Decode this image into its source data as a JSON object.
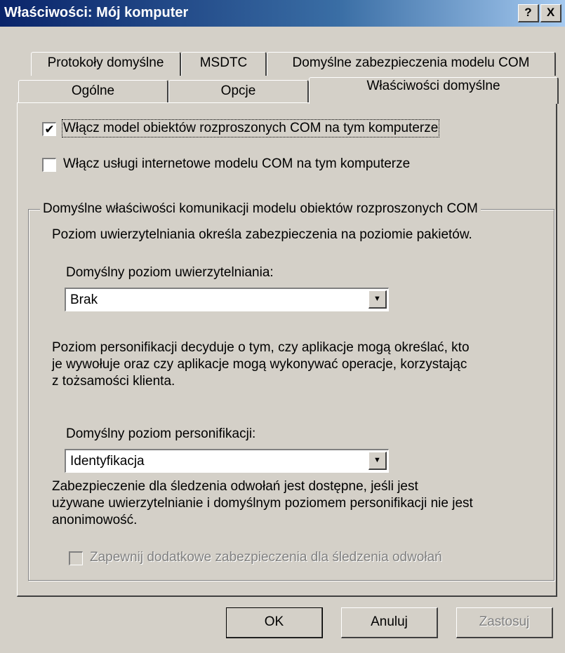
{
  "window": {
    "title": "Właściwości: Mój komputer",
    "help_btn": "?",
    "close_btn": "X"
  },
  "tabs": {
    "row1": [
      {
        "label": "Protokoły domyślne"
      },
      {
        "label": "MSDTC"
      },
      {
        "label": "Domyślne zabezpieczenia modelu COM"
      }
    ],
    "row2": [
      {
        "label": "Ogólne"
      },
      {
        "label": "Opcje"
      },
      {
        "label": "Właściwości domyślne",
        "active": true
      }
    ]
  },
  "options": {
    "enable_dcom": {
      "label": "Włącz model obiektów rozproszonych COM na tym komputerze",
      "checked": true
    },
    "enable_com_internet": {
      "label": "Włącz usługi internetowe modelu COM na tym komputerze",
      "checked": false
    }
  },
  "group": {
    "legend": "Domyślne właściwości komunikacji modelu obiektów rozproszonych COM",
    "auth_desc": "Poziom uwierzytelniania określa zabezpieczenia na poziomie pakietów.",
    "auth_label": "Domyślny poziom uwierzytelniania:",
    "auth_value": "Brak",
    "imp_desc_lines": [
      "Poziom personifikacji decyduje o tym, czy aplikacje mogą określać, kto",
      "je wywołuje oraz czy aplikacje mogą wykonywać operacje, korzystając",
      "z tożsamości klienta."
    ],
    "imp_label": "Domyślny poziom personifikacji:",
    "imp_value": "Identyfikacja",
    "ref_desc_lines": [
      "Zabezpieczenie dla śledzenia odwołań jest dostępne, jeśli jest",
      "używane uwierzytelnianie i domyślnym poziomem personifikacji nie jest",
      "anonimowość."
    ],
    "ref_check_label": "Zapewnij dodatkowe zabezpieczenia dla śledzenia odwołań",
    "ref_check_checked": false,
    "ref_check_disabled": true
  },
  "buttons": {
    "ok": "OK",
    "cancel": "Anuluj",
    "apply": "Zastosuj"
  }
}
